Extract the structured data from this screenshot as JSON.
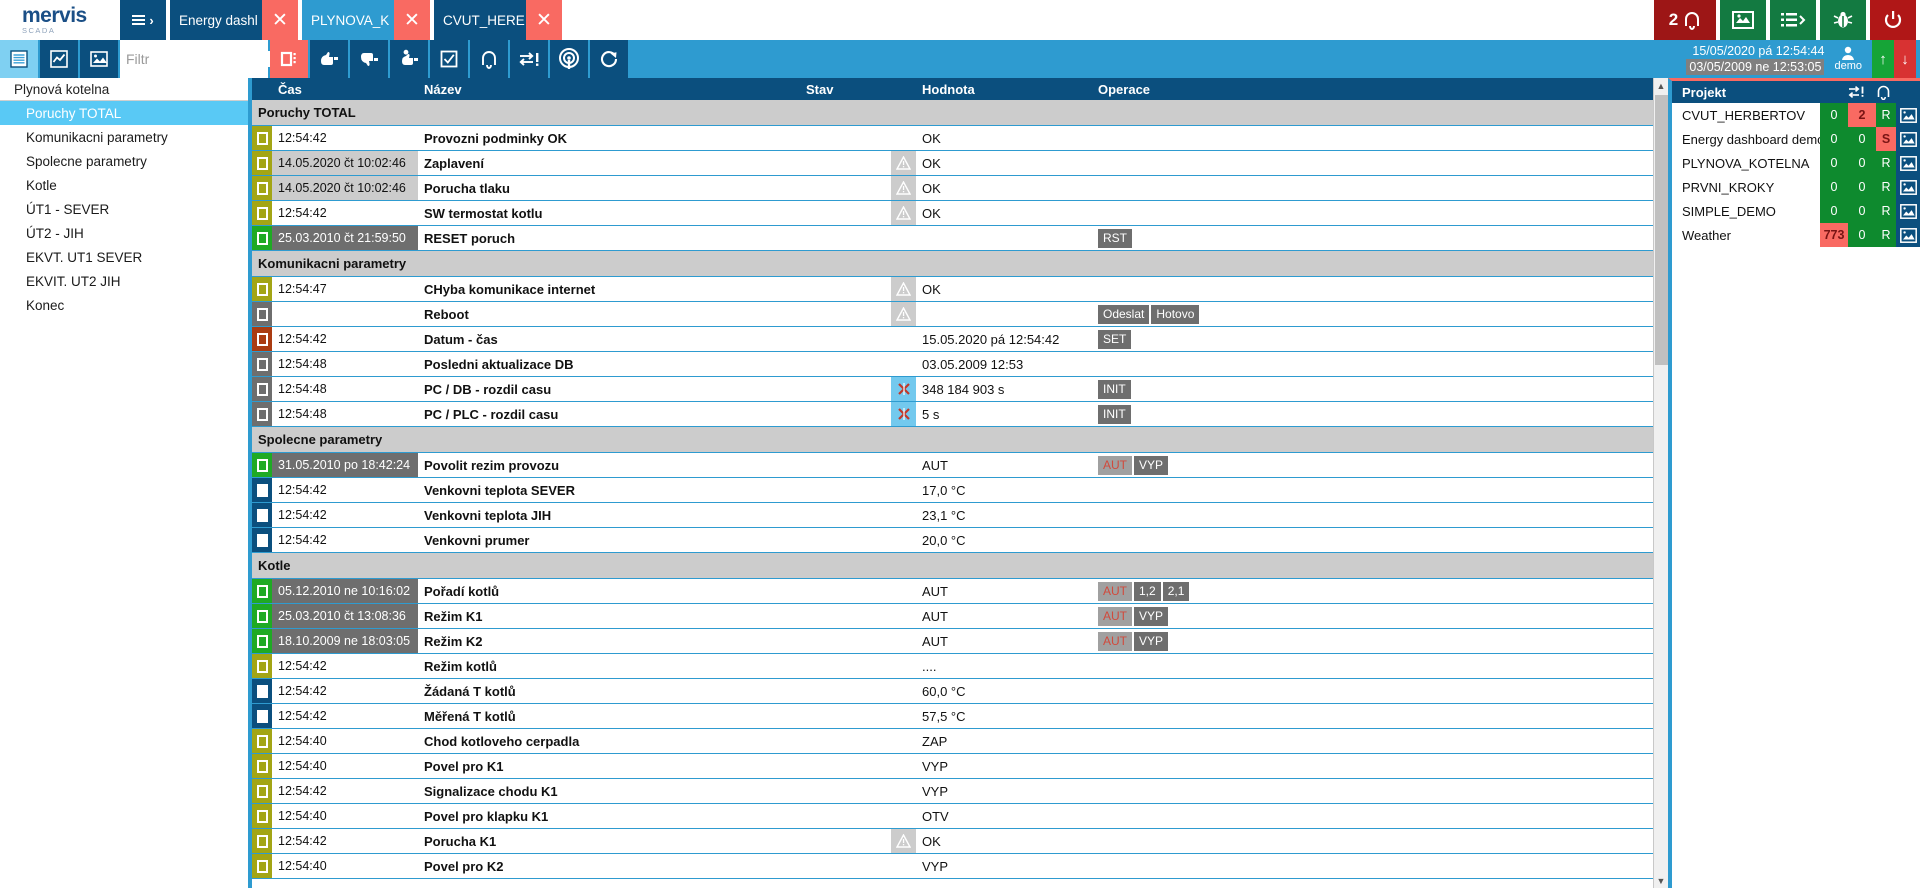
{
  "brand": {
    "name": "mervis",
    "sub": "SCADA"
  },
  "tabs": [
    {
      "label": "Energy dashl",
      "active": false,
      "close": "✕"
    },
    {
      "label": "PLYNOVA_K",
      "active": true,
      "close": "✕"
    },
    {
      "label": "CVUT_HERE",
      "active": false,
      "close": "✕"
    }
  ],
  "top_right": {
    "alarm_count": "2",
    "buttons": [
      "alarm-bell",
      "map",
      "list-menu",
      "bug",
      "power"
    ]
  },
  "toolbar": {
    "buttons": [
      "list-view-icon",
      "chart-icon",
      "image-icon"
    ],
    "filter_placeholder": "Filtr",
    "filter_value": "",
    "filter_clear": "✕",
    "right_buttons": [
      "select-box-icon",
      "thumb-up-icon",
      "thumb-down-icon",
      "thumb-question-icon",
      "checkbox-icon",
      "bell-icon",
      "transfer-alert-icon",
      "broadcast-icon",
      "refresh-icon"
    ]
  },
  "clock": {
    "line1": "15/05/2020 pá 12:54:44",
    "line2": "03/05/2009 ne 12:53:05",
    "user": "demo",
    "up": "↑",
    "down": "↓"
  },
  "sidebar": {
    "title": "Plynová kotelna",
    "items": [
      {
        "label": "Poruchy TOTAL",
        "active": true
      },
      {
        "label": "Komunikacni parametry",
        "active": false
      },
      {
        "label": "Spolecne parametry",
        "active": false
      },
      {
        "label": "Kotle",
        "active": false
      },
      {
        "label": "ÚT1 - SEVER",
        "active": false
      },
      {
        "label": "ÚT2 - JIH",
        "active": false
      },
      {
        "label": "EKVT. UT1 SEVER",
        "active": false
      },
      {
        "label": "EKVIT. UT2 JIH",
        "active": false
      },
      {
        "label": "Konec",
        "active": false
      }
    ]
  },
  "table": {
    "headers": {
      "time": "Čas",
      "name": "Název",
      "stav": "Stav",
      "hodnota": "Hodnota",
      "operace": "Operace"
    },
    "rows": [
      {
        "type": "group",
        "label": "Poruchy TOTAL"
      },
      {
        "type": "row",
        "ind": "olive",
        "timeStyle": "none",
        "time": "12:54:42",
        "name": "Provozni podminky OK",
        "stav": "",
        "hodnota": "OK",
        "ops": []
      },
      {
        "type": "row",
        "ind": "olive",
        "timeStyle": "lt",
        "time": "14.05.2020 čt 10:02:46",
        "name": "Zaplavení",
        "stav": "warn",
        "hodnota": "OK",
        "ops": []
      },
      {
        "type": "row",
        "ind": "olive",
        "timeStyle": "lt",
        "time": "14.05.2020 čt 10:02:46",
        "name": "Porucha tlaku",
        "stav": "warn",
        "hodnota": "OK",
        "ops": []
      },
      {
        "type": "row",
        "ind": "olive",
        "timeStyle": "none",
        "time": "12:54:42",
        "name": "SW termostat kotlu",
        "stav": "warn",
        "hodnota": "OK",
        "ops": []
      },
      {
        "type": "row",
        "ind": "green",
        "timeStyle": "dk",
        "time": "25.03.2010 čt 21:59:50",
        "name": "RESET poruch",
        "stav": "",
        "hodnota": "",
        "ops": [
          {
            "label": "RST",
            "style": "dark"
          }
        ]
      },
      {
        "type": "group",
        "label": "Komunikacni parametry"
      },
      {
        "type": "row",
        "ind": "olive",
        "timeStyle": "none",
        "time": "12:54:47",
        "name": "CHyba komunikace internet",
        "stav": "warn",
        "hodnota": "OK",
        "ops": []
      },
      {
        "type": "row",
        "ind": "gray",
        "timeStyle": "none",
        "time": "",
        "name": "Reboot",
        "stav": "warn",
        "hodnota": "",
        "ops": [
          {
            "label": "Odeslat",
            "style": "dark"
          },
          {
            "label": "Hotovo",
            "style": "dark"
          }
        ]
      },
      {
        "type": "row",
        "ind": "rust",
        "timeStyle": "none",
        "time": "12:54:42",
        "name": "Datum - čas",
        "stav": "",
        "hodnota": "15.05.2020 pá 12:54:42",
        "ops": [
          {
            "label": "SET",
            "style": "dark"
          }
        ]
      },
      {
        "type": "row",
        "ind": "gray",
        "timeStyle": "none",
        "time": "12:54:48",
        "name": "Posledni aktualizace DB",
        "stav": "",
        "hodnota": "03.05.2009 12:53",
        "ops": []
      },
      {
        "type": "row",
        "ind": "gray",
        "timeStyle": "none",
        "time": "12:54:48",
        "name": "PC / DB - rozdil casu",
        "stav": "xred",
        "hodnota": "348 184 903 s",
        "ops": [
          {
            "label": "INIT",
            "style": "dark"
          }
        ]
      },
      {
        "type": "row",
        "ind": "gray",
        "timeStyle": "none",
        "time": "12:54:48",
        "name": "PC / PLC - rozdil casu",
        "stav": "xred",
        "hodnota": "5 s",
        "ops": [
          {
            "label": "INIT",
            "style": "dark"
          }
        ]
      },
      {
        "type": "group",
        "label": "Spolecne parametry"
      },
      {
        "type": "row",
        "ind": "green",
        "timeStyle": "dk",
        "time": "31.05.2010 po 18:42:24",
        "name": "Povolit rezim provozu",
        "stav": "",
        "hodnota": "AUT",
        "ops": [
          {
            "label": "AUT",
            "style": "light"
          },
          {
            "label": "VYP",
            "style": "dark"
          }
        ]
      },
      {
        "type": "row",
        "ind": "blue",
        "timeStyle": "none",
        "time": "12:54:42",
        "name": "Venkovni teplota SEVER",
        "stav": "",
        "hodnota": "17,0 °C",
        "ops": []
      },
      {
        "type": "row",
        "ind": "blue",
        "timeStyle": "none",
        "time": "12:54:42",
        "name": "Venkovni teplota JIH",
        "stav": "",
        "hodnota": "23,1 °C",
        "ops": []
      },
      {
        "type": "row",
        "ind": "blue",
        "timeStyle": "none",
        "time": "12:54:42",
        "name": "Venkovni prumer",
        "stav": "",
        "hodnota": "20,0 °C",
        "ops": []
      },
      {
        "type": "group",
        "label": "Kotle"
      },
      {
        "type": "row",
        "ind": "green",
        "timeStyle": "dk",
        "time": "05.12.2010 ne 10:16:02",
        "name": "Pořadí kotlů",
        "stav": "",
        "hodnota": "AUT",
        "ops": [
          {
            "label": "AUT",
            "style": "light"
          },
          {
            "label": "1,2",
            "style": "dark"
          },
          {
            "label": "2,1",
            "style": "dark"
          }
        ]
      },
      {
        "type": "row",
        "ind": "green",
        "timeStyle": "dk",
        "time": "25.03.2010 čt 13:08:36",
        "name": "Režim K1",
        "stav": "",
        "hodnota": "AUT",
        "ops": [
          {
            "label": "AUT",
            "style": "light"
          },
          {
            "label": "VYP",
            "style": "dark"
          }
        ]
      },
      {
        "type": "row",
        "ind": "green",
        "timeStyle": "dk",
        "time": "18.10.2009 ne 18:03:05",
        "name": "Režim K2",
        "stav": "",
        "hodnota": "AUT",
        "ops": [
          {
            "label": "AUT",
            "style": "light"
          },
          {
            "label": "VYP",
            "style": "dark"
          }
        ]
      },
      {
        "type": "row",
        "ind": "olive",
        "timeStyle": "none",
        "time": "12:54:42",
        "name": "Režim kotlů",
        "stav": "",
        "hodnota": "....",
        "ops": []
      },
      {
        "type": "row",
        "ind": "blue",
        "timeStyle": "none",
        "time": "12:54:42",
        "name": "Žádaná T kotlů",
        "stav": "",
        "hodnota": "60,0 °C",
        "ops": []
      },
      {
        "type": "row",
        "ind": "blue",
        "timeStyle": "none",
        "time": "12:54:42",
        "name": "Měřená T kotlů",
        "stav": "",
        "hodnota": "57,5 °C",
        "ops": []
      },
      {
        "type": "row",
        "ind": "olive",
        "timeStyle": "none",
        "time": "12:54:40",
        "name": "Chod kotloveho cerpadla",
        "stav": "",
        "hodnota": "ZAP",
        "ops": []
      },
      {
        "type": "row",
        "ind": "olive",
        "timeStyle": "none",
        "time": "12:54:40",
        "name": "Povel pro K1",
        "stav": "",
        "hodnota": "VYP",
        "ops": []
      },
      {
        "type": "row",
        "ind": "olive",
        "timeStyle": "none",
        "time": "12:54:42",
        "name": "Signalizace chodu K1",
        "stav": "",
        "hodnota": "VYP",
        "ops": []
      },
      {
        "type": "row",
        "ind": "olive",
        "timeStyle": "none",
        "time": "12:54:40",
        "name": "Povel pro klapku K1",
        "stav": "",
        "hodnota": "OTV",
        "ops": []
      },
      {
        "type": "row",
        "ind": "olive",
        "timeStyle": "none",
        "time": "12:54:42",
        "name": "Porucha K1",
        "stav": "warn",
        "hodnota": "OK",
        "ops": []
      },
      {
        "type": "row",
        "ind": "olive",
        "timeStyle": "none",
        "time": "12:54:40",
        "name": "Povel pro K2",
        "stav": "",
        "hodnota": "VYP",
        "ops": []
      }
    ]
  },
  "projects": {
    "header": "Projekt",
    "rows": [
      {
        "name": "CVUT_HERBERTOV",
        "n1": "0",
        "n1alert": false,
        "n2": "2",
        "n2alert": true,
        "st": "R",
        "stalert": false
      },
      {
        "name": "Energy dashboard demo",
        "n1": "0",
        "n1alert": false,
        "n2": "0",
        "n2alert": false,
        "st": "S",
        "stalert": true
      },
      {
        "name": "PLYNOVA_KOTELNA",
        "n1": "0",
        "n1alert": false,
        "n2": "0",
        "n2alert": false,
        "st": "R",
        "stalert": false
      },
      {
        "name": "PRVNI_KROKY",
        "n1": "0",
        "n1alert": false,
        "n2": "0",
        "n2alert": false,
        "st": "R",
        "stalert": false
      },
      {
        "name": "SIMPLE_DEMO",
        "n1": "0",
        "n1alert": false,
        "n2": "0",
        "n2alert": false,
        "st": "R",
        "stalert": false
      },
      {
        "name": "Weather",
        "n1": "773",
        "n1alert": true,
        "n2": "0",
        "n2alert": false,
        "st": "R",
        "stalert": false
      }
    ]
  },
  "colors": {
    "brand_blue": "#0b4f7e",
    "accent_blue": "#2e9bd0",
    "tab_red": "#f96a62",
    "alarm_red": "#9d1616",
    "green": "#0e8a2e"
  }
}
